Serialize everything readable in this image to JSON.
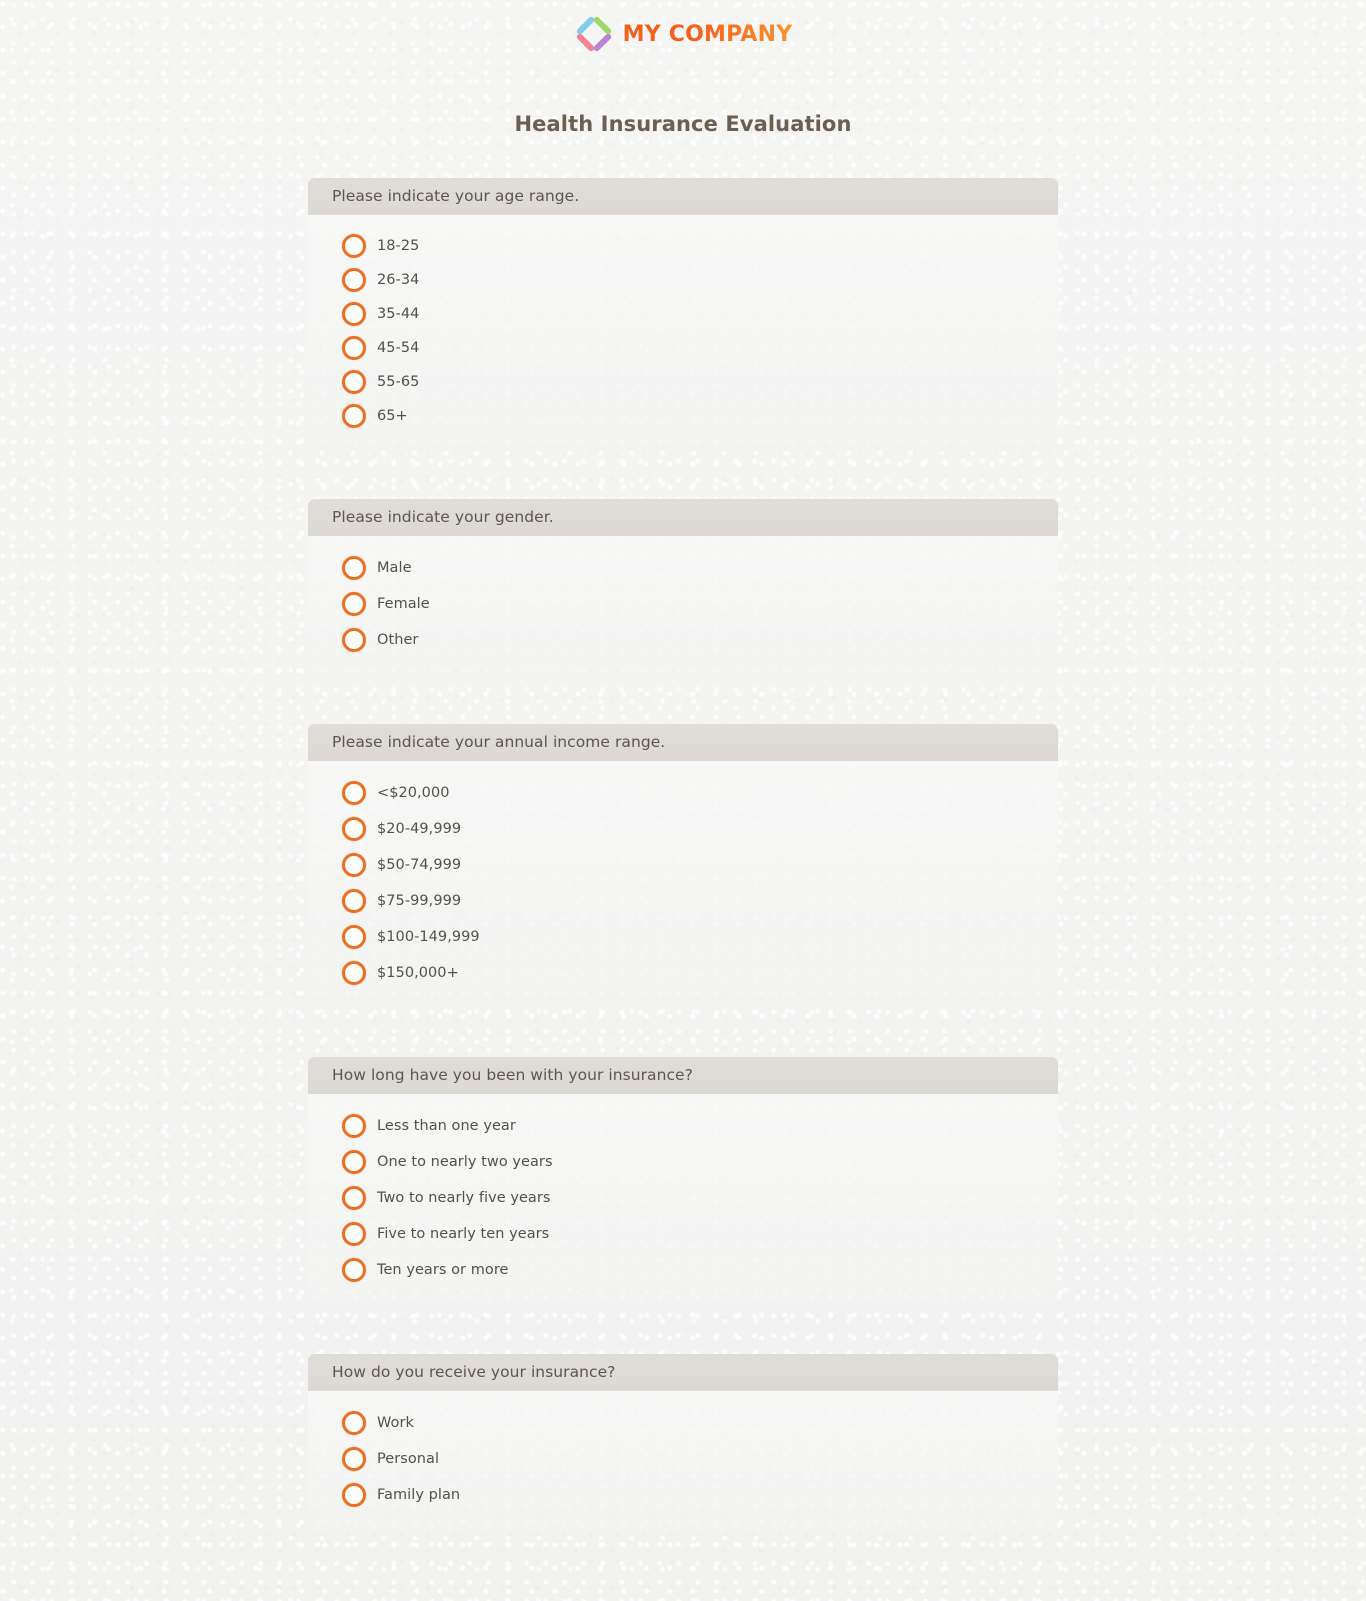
{
  "brand": {
    "logo_icon": "pinwheel-diamond-logo-icon",
    "name": "MY COMPANY",
    "accent_orange": "#f4611b",
    "accent_orange_light": "#fb9330",
    "logo_segment_colors": {
      "top": "#8fd14f",
      "right": "#b06ed0",
      "bottom": "#f06e80",
      "left": "#6cc4e8"
    }
  },
  "page": {
    "title": "Health Insurance Evaluation",
    "title_color": "#6b5f52",
    "background_color": "#f4f4f3",
    "radio_color": "#ea7124",
    "header_bar_color": "#ded9d4"
  },
  "questions": [
    {
      "id": "age-range",
      "prompt": "Please indicate your age range.",
      "options": [
        "18-25",
        "26-34",
        "35-44",
        "45-54",
        "55-65",
        "65+"
      ]
    },
    {
      "id": "gender",
      "prompt": "Please indicate your gender.",
      "options": [
        "Male",
        "Female",
        "Other"
      ]
    },
    {
      "id": "annual-income-range",
      "prompt": "Please indicate your annual income range.",
      "options": [
        "<$20,000",
        "$20-49,999",
        "$50-74,999",
        "$75-99,999",
        "$100-149,999",
        "$150,000+"
      ]
    },
    {
      "id": "insurance-tenure",
      "prompt": "How long have you been with your insurance?",
      "options": [
        "Less than one year",
        "One to nearly two years",
        "Two to nearly five years",
        "Five to nearly ten years",
        "Ten years or more"
      ]
    },
    {
      "id": "insurance-source",
      "prompt": "How do you receive your insurance?",
      "options": [
        "Work",
        "Personal",
        "Family plan"
      ]
    }
  ]
}
